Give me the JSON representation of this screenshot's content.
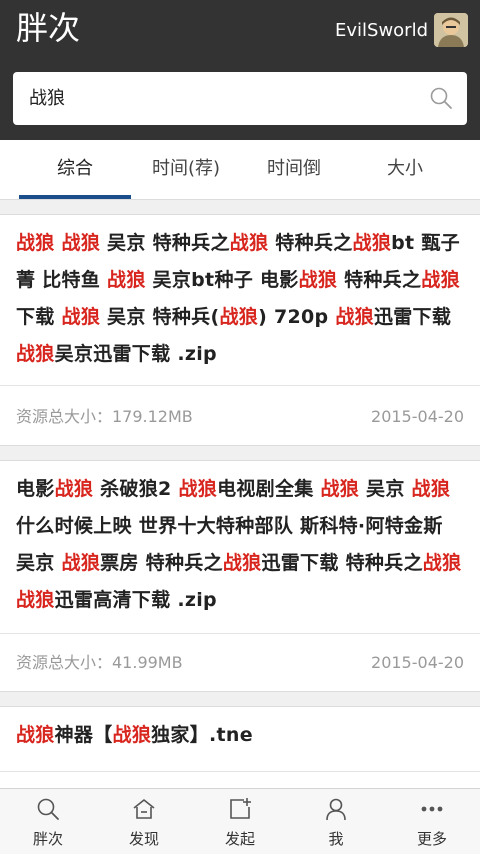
{
  "app": {
    "title": "胖次"
  },
  "user": {
    "name": "EvilSworld"
  },
  "search": {
    "value": "战狼"
  },
  "tabs": [
    {
      "label": "综合",
      "active": true
    },
    {
      "label": "时间(荐)"
    },
    {
      "label": "时间倒"
    },
    {
      "label": "大小"
    }
  ],
  "results": [
    {
      "title_parts": [
        {
          "t": "战狼",
          "hl": true
        },
        {
          "t": " "
        },
        {
          "t": "战狼",
          "hl": true
        },
        {
          "t": " 吴京 特种兵之"
        },
        {
          "t": "战狼",
          "hl": true
        },
        {
          "t": " 特种兵之"
        },
        {
          "t": "战狼",
          "hl": true
        },
        {
          "t": "bt 甄子菁 比特鱼 "
        },
        {
          "t": "战狼",
          "hl": true
        },
        {
          "t": " 吴京bt种子 电影"
        },
        {
          "t": "战狼",
          "hl": true
        },
        {
          "t": " 特种兵之"
        },
        {
          "t": "战狼",
          "hl": true
        },
        {
          "t": "下载 "
        },
        {
          "t": "战狼",
          "hl": true
        },
        {
          "t": " 吴京 特种兵("
        },
        {
          "t": "战狼",
          "hl": true
        },
        {
          "t": ") 720p "
        },
        {
          "t": "战狼",
          "hl": true
        },
        {
          "t": "迅雷下载 "
        },
        {
          "t": "战狼",
          "hl": true
        },
        {
          "t": "吴京迅雷下载 .zip"
        }
      ],
      "size": "资源总大小：179.12MB",
      "date": "2015-04-20"
    },
    {
      "title_parts": [
        {
          "t": "电影"
        },
        {
          "t": "战狼",
          "hl": true
        },
        {
          "t": " 杀破狼2 "
        },
        {
          "t": "战狼",
          "hl": true
        },
        {
          "t": "电视剧全集 "
        },
        {
          "t": "战狼",
          "hl": true
        },
        {
          "t": " 吴京 "
        },
        {
          "t": "战狼",
          "hl": true
        },
        {
          "t": "什么时候上映 世界十大特种部队 斯科特·阿特金斯 吴京 "
        },
        {
          "t": "战狼",
          "hl": true
        },
        {
          "t": "票房 特种兵之"
        },
        {
          "t": "战狼",
          "hl": true
        },
        {
          "t": "迅雷下载 特种兵之"
        },
        {
          "t": "战狼",
          "hl": true
        },
        {
          "t": " "
        },
        {
          "t": "战狼",
          "hl": true
        },
        {
          "t": "迅雷高清下载 .zip"
        }
      ],
      "size": "资源总大小：41.99MB",
      "date": "2015-04-20"
    },
    {
      "title_parts": [
        {
          "t": "战狼",
          "hl": true
        },
        {
          "t": "神器【"
        },
        {
          "t": "战狼",
          "hl": true
        },
        {
          "t": "独家】.tne"
        }
      ]
    }
  ],
  "bottom_nav": [
    {
      "label": "胖次",
      "icon": "search-icon"
    },
    {
      "label": "发现",
      "icon": "home-icon"
    },
    {
      "label": "发起",
      "icon": "create-icon"
    },
    {
      "label": "我",
      "icon": "user-icon"
    },
    {
      "label": "更多",
      "icon": "more-icon"
    }
  ],
  "colors": {
    "header": "#333333",
    "highlight": "#d8261f",
    "tab_underline": "#1a4f8b"
  }
}
